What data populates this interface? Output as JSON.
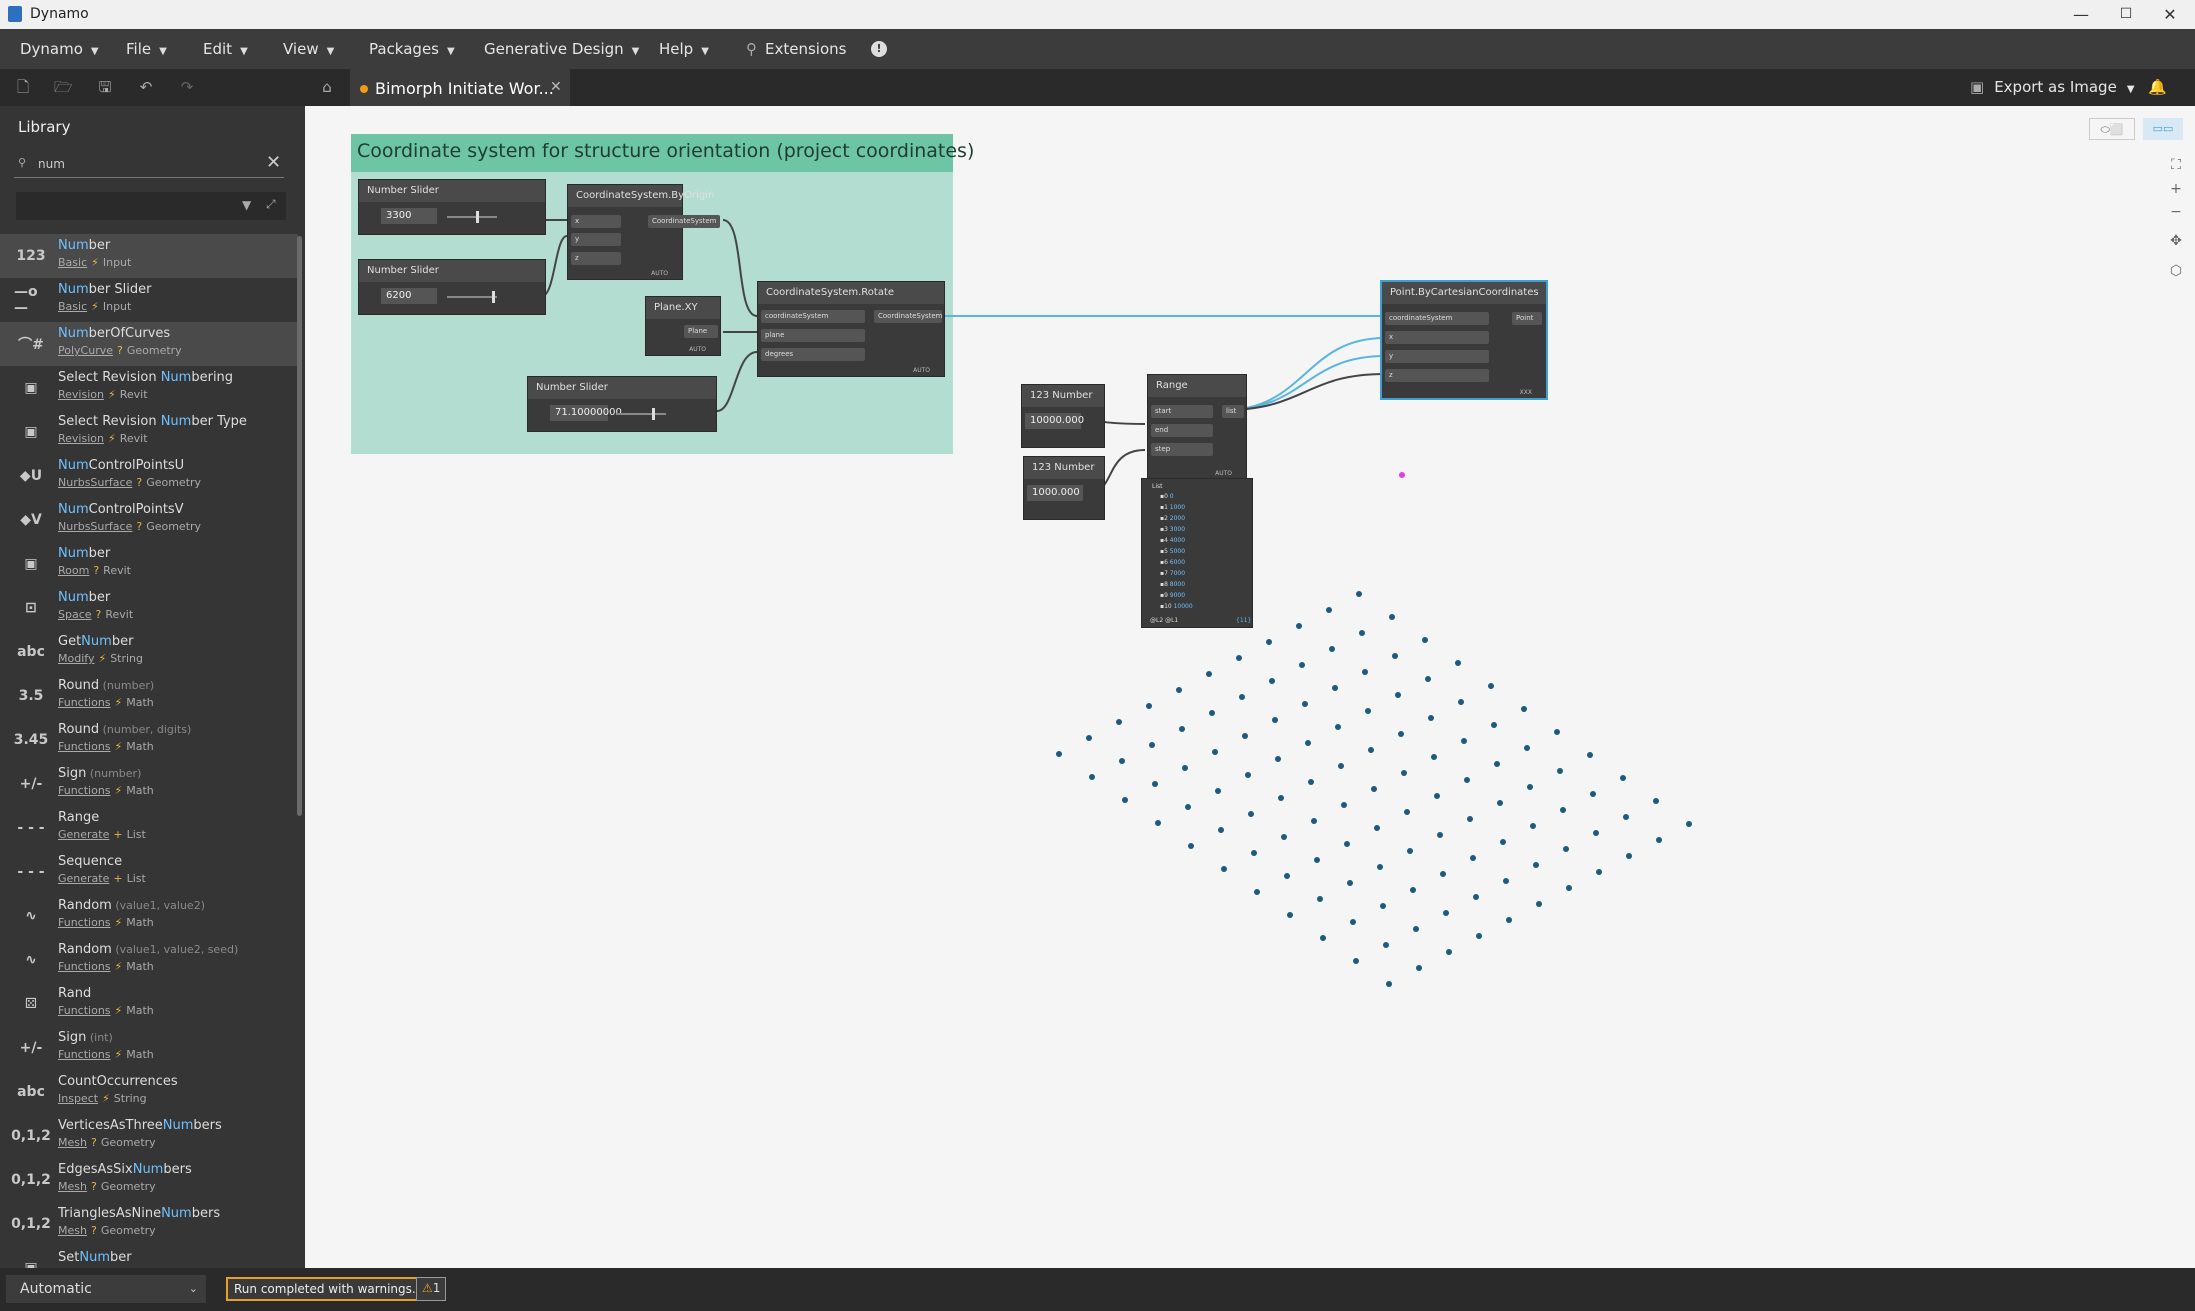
{
  "window": {
    "title": "Dynamo",
    "minimize": "—",
    "maximize": "☐",
    "close": "✕"
  },
  "menu": [
    "Dynamo",
    "File",
    "Edit",
    "View",
    "Packages",
    "Generative Design",
    "Help"
  ],
  "menu_extensions": "Extensions",
  "menu_info": "!",
  "tab": {
    "label": "Bimorph Initiate Wor...",
    "close": "✕",
    "modified": true
  },
  "export_label": "Export as Image",
  "library": {
    "title": "Library",
    "search_value": "num",
    "results": [
      {
        "icon": "123",
        "pre": "",
        "hi": "Num",
        "post": "ber",
        "args": "",
        "category": "Basic",
        "sym": "⚡",
        "group": "Input"
      },
      {
        "icon": "—o—",
        "pre": "",
        "hi": "Num",
        "post": "ber Slider",
        "args": "",
        "category": "Basic",
        "sym": "⚡",
        "group": "Input"
      },
      {
        "icon": "⌒#",
        "pre": "",
        "hi": "Num",
        "post": "berOfCurves",
        "args": "",
        "category": "PolyCurve",
        "sym": "?",
        "group": "Geometry"
      },
      {
        "icon": "▣",
        "pre": "Select Revision ",
        "hi": "Num",
        "post": "bering",
        "args": "",
        "category": "Revision",
        "sym": "⚡",
        "group": "Revit"
      },
      {
        "icon": "▣",
        "pre": "Select Revision ",
        "hi": "Num",
        "post": "ber Type",
        "args": "",
        "category": "Revision",
        "sym": "⚡",
        "group": "Revit"
      },
      {
        "icon": "◆U",
        "pre": "",
        "hi": "Num",
        "post": "ControlPointsU",
        "args": "",
        "category": "NurbsSurface",
        "sym": "?",
        "group": "Geometry"
      },
      {
        "icon": "◆V",
        "pre": "",
        "hi": "Num",
        "post": "ControlPointsV",
        "args": "",
        "category": "NurbsSurface",
        "sym": "?",
        "group": "Geometry"
      },
      {
        "icon": "▣",
        "pre": "",
        "hi": "Num",
        "post": "ber",
        "args": "",
        "category": "Room",
        "sym": "?",
        "group": "Revit"
      },
      {
        "icon": "⊡",
        "pre": "",
        "hi": "Num",
        "post": "ber",
        "args": "",
        "category": "Space",
        "sym": "?",
        "group": "Revit"
      },
      {
        "icon": "abc",
        "pre": "Get",
        "hi": "Num",
        "post": "ber",
        "args": "",
        "category": "Modify",
        "sym": "⚡",
        "group": "String"
      },
      {
        "icon": "3.5",
        "pre": "Round",
        "hi": "",
        "post": "",
        "args": " (number)",
        "category": "Functions",
        "sym": "⚡",
        "group": "Math"
      },
      {
        "icon": "3.45",
        "pre": "Round",
        "hi": "",
        "post": "",
        "args": " (number, digits)",
        "category": "Functions",
        "sym": "⚡",
        "group": "Math"
      },
      {
        "icon": "+/-",
        "pre": "Sign",
        "hi": "",
        "post": "",
        "args": " (number)",
        "category": "Functions",
        "sym": "⚡",
        "group": "Math"
      },
      {
        "icon": "- - -",
        "pre": "Range",
        "hi": "",
        "post": "",
        "args": "",
        "category": "Generate",
        "sym": "+",
        "group": "List"
      },
      {
        "icon": "- - -",
        "pre": "Sequence",
        "hi": "",
        "post": "",
        "args": "",
        "category": "Generate",
        "sym": "+",
        "group": "List"
      },
      {
        "icon": "∿",
        "pre": "Random",
        "hi": "",
        "post": "",
        "args": " (value1, value2)",
        "category": "Functions",
        "sym": "⚡",
        "group": "Math"
      },
      {
        "icon": "∿",
        "pre": "Random",
        "hi": "",
        "post": "",
        "args": " (value1, value2, seed)",
        "category": "Functions",
        "sym": "⚡",
        "group": "Math"
      },
      {
        "icon": "⚄",
        "pre": "Rand",
        "hi": "",
        "post": "",
        "args": "",
        "category": "Functions",
        "sym": "⚡",
        "group": "Math"
      },
      {
        "icon": "+/-",
        "pre": "Sign",
        "hi": "",
        "post": "",
        "args": " (int)",
        "category": "Functions",
        "sym": "⚡",
        "group": "Math"
      },
      {
        "icon": "abc",
        "pre": "CountOccurrences",
        "hi": "",
        "post": "",
        "args": "",
        "category": "Inspect",
        "sym": "⚡",
        "group": "String"
      },
      {
        "icon": "0,1,2",
        "pre": "VerticesAsThree",
        "hi": "Num",
        "post": "bers",
        "args": "",
        "category": "Mesh",
        "sym": "?",
        "group": "Geometry"
      },
      {
        "icon": "0,1,2",
        "pre": "EdgesAsSix",
        "hi": "Num",
        "post": "bers",
        "args": "",
        "category": "Mesh",
        "sym": "?",
        "group": "Geometry"
      },
      {
        "icon": "0,1,2",
        "pre": "TrianglesAsNine",
        "hi": "Num",
        "post": "bers",
        "args": "",
        "category": "Mesh",
        "sym": "?",
        "group": "Geometry"
      },
      {
        "icon": "▣",
        "pre": "Set",
        "hi": "Num",
        "post": "ber",
        "args": "",
        "category": "",
        "sym": "",
        "group": ""
      }
    ]
  },
  "canvas": {
    "group_title": "Coordinate system for structure orientation (project coordinates)",
    "nodes": {
      "slider1": {
        "title": "Number Slider",
        "value": "3300"
      },
      "slider2": {
        "title": "Number Slider",
        "value": "6200"
      },
      "slider3": {
        "title": "Number Slider",
        "value": "71.10000000"
      },
      "cs_origin": {
        "title": "CoordinateSystem.ByOrigin",
        "ports": [
          "x",
          "y",
          "z"
        ],
        "out": "CoordinateSystem"
      },
      "plane_xy": {
        "title": "Plane.XY",
        "out": "Plane"
      },
      "cs_rotate": {
        "title": "CoordinateSystem.Rotate",
        "ports": [
          "coordinateSystem",
          "plane",
          "degrees"
        ],
        "out": "CoordinateSystem"
      },
      "point_cart": {
        "title": "Point.ByCartesianCoordinates",
        "ports": [
          "coordinateSystem",
          "x",
          "y",
          "z"
        ],
        "out": "Point"
      },
      "number1": {
        "title": "Number",
        "value": "10000.000"
      },
      "number2": {
        "title": "Number",
        "value": "1000.000"
      },
      "range": {
        "title": "Range",
        "ports": [
          "start",
          "end",
          "step"
        ],
        "out": "list"
      },
      "watch": {
        "header": "List",
        "items": [
          "0",
          "1000",
          "2000",
          "3000",
          "4000",
          "5000",
          "6000",
          "7000",
          "8000",
          "9000",
          "10000"
        ],
        "footer_left": "@L2 @L1",
        "footer_right": "{11}"
      }
    },
    "auto_label": "AUTO",
    "xxx_label": "XXX"
  },
  "status": {
    "run_mode": "Automatic",
    "run_message": "Run completed with warnings.",
    "warnings": "1"
  },
  "colors": {
    "accent": "#3aa0d8",
    "group_header": "#6dc5a5",
    "group_body": "#b2ddd0",
    "warning": "#e8a02d",
    "point": "#1c5a80"
  }
}
